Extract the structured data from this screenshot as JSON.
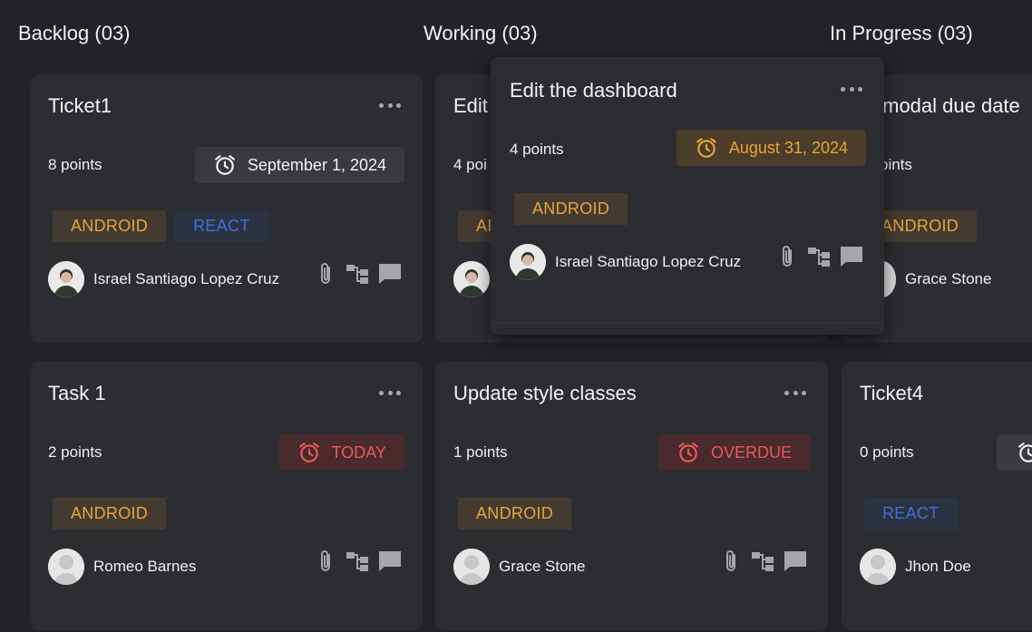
{
  "columns": [
    {
      "title": "Backlog (03)"
    },
    {
      "title": "Working (03)"
    },
    {
      "title": "In Progress (03)"
    }
  ],
  "cards": {
    "c1": {
      "title": "Ticket1",
      "points": "8 points",
      "due": "September 1, 2024",
      "tags": [
        "ANDROID",
        "REACT"
      ],
      "assignee": "Israel Santiago Lopez Cruz"
    },
    "c2": {
      "title": "Edit",
      "points": "4 poi",
      "tag": "AI"
    },
    "c3": {
      "title": "k modal due date",
      "points": "oints",
      "tag": "ANDROID",
      "assignee": "Grace Stone"
    },
    "c4": {
      "title": "Task 1",
      "points": "2 points",
      "due": "TODAY",
      "tags": [
        "ANDROID"
      ],
      "assignee": "Romeo Barnes"
    },
    "c5": {
      "title": "Update style classes",
      "points": "1 points",
      "due": "OVERDUE",
      "tags": [
        "ANDROID"
      ],
      "assignee": "Grace Stone"
    },
    "c6": {
      "title": "Ticket4",
      "points": "0 points",
      "tags": [
        "REACT"
      ],
      "assignee": "Jhon Doe"
    }
  },
  "popup": {
    "title": "Edit the dashboard",
    "points": "4 points",
    "due": "August 31, 2024",
    "tags": [
      "ANDROID"
    ],
    "assignee": "Israel Santiago Lopez Cruz"
  },
  "colors": {
    "background": "#222326",
    "card": "#2c2d31",
    "android": "#e7a43b",
    "react": "#3e6fd8",
    "danger": "#e65b56"
  },
  "icons": [
    "more-horizontal-icon",
    "alarm-clock-icon",
    "paperclip-icon",
    "subtasks-icon",
    "comment-icon"
  ]
}
